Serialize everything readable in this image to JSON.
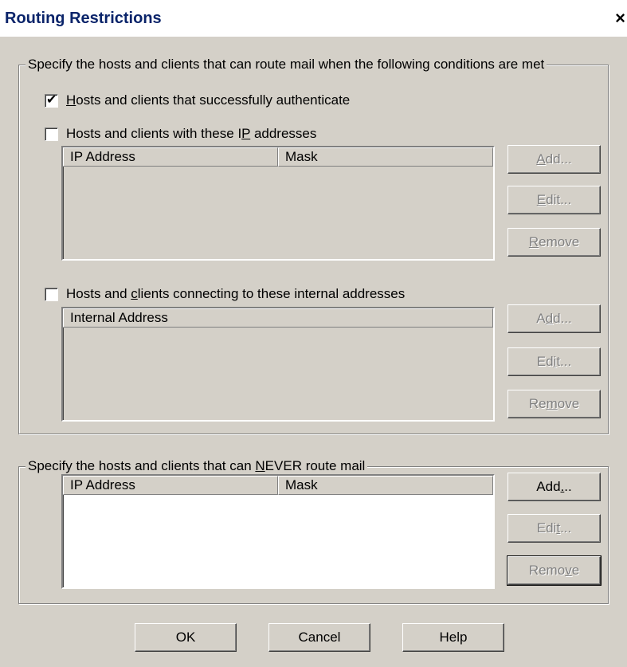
{
  "window": {
    "title": "Routing Restrictions",
    "close_glyph": "×"
  },
  "allow_group": {
    "title": "Specify the hosts and clients that can route mail when the following conditions are met",
    "auth_checkbox": {
      "checked": true,
      "label_pre": "",
      "label_hk": "H",
      "label_post": "osts and clients that successfully authenticate"
    },
    "ip_checkbox": {
      "checked": false,
      "label_pre": "Hosts and clients with these I",
      "label_hk": "P",
      "label_post": " addresses"
    },
    "ip_list": {
      "columns": [
        "IP Address",
        "Mask"
      ]
    },
    "ip_buttons": [
      {
        "pre": "",
        "hk": "A",
        "post": "dd...",
        "enabled": false
      },
      {
        "pre": "",
        "hk": "E",
        "post": "dit...",
        "enabled": false
      },
      {
        "pre": "",
        "hk": "R",
        "post": "emove",
        "enabled": false
      }
    ],
    "internal_checkbox": {
      "checked": false,
      "label_pre": "Hosts and ",
      "label_hk": "c",
      "label_post": "lients connecting to these internal addresses"
    },
    "internal_list": {
      "columns": [
        "Internal Address"
      ]
    },
    "internal_buttons": [
      {
        "pre": "A",
        "hk": "d",
        "post": "d...",
        "enabled": false
      },
      {
        "pre": "Ed",
        "hk": "i",
        "post": "t...",
        "enabled": false
      },
      {
        "pre": "Re",
        "hk": "m",
        "post": "ove",
        "enabled": false
      }
    ]
  },
  "deny_group": {
    "title_pre": "Specify the hosts and clients that can ",
    "title_hk": "N",
    "title_post": "EVER route mail",
    "list": {
      "columns": [
        "IP Address",
        "Mask"
      ]
    },
    "buttons": [
      {
        "pre": "Add",
        "hk": ".",
        "post": "..",
        "enabled": true
      },
      {
        "pre": "Edi",
        "hk": "t",
        "post": "...",
        "enabled": false
      },
      {
        "pre": "Remo",
        "hk": "v",
        "post": "e",
        "enabled": false
      }
    ]
  },
  "footer": {
    "ok": "OK",
    "cancel": "Cancel",
    "help": "Help"
  }
}
